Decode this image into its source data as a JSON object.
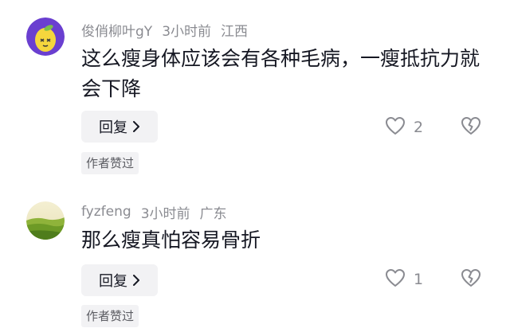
{
  "comments": [
    {
      "username": "俊俏柳叶gY",
      "time": "3小时前",
      "location": "江西",
      "content": "这么瘦身体应该会有各种毛病，一瘦抵抗力就会下降",
      "reply_label": "回复",
      "like_count": "2",
      "author_tag": "作者赞过",
      "avatar_icon": "lemon-avatar-icon"
    },
    {
      "username": "fyzfeng",
      "time": "3小时前",
      "location": "广东",
      "content": "那么瘦真怕容易骨折",
      "reply_label": "回复",
      "like_count": "1",
      "author_tag": "作者赞过",
      "avatar_icon": "landscape-avatar-icon"
    }
  ],
  "colors": {
    "meta_text": "#8a8b91",
    "content_text": "#161823",
    "button_bg": "#f2f2f4",
    "avatar_purple": "#6a3fd0",
    "lemon": "#f5d63d"
  },
  "icons": [
    "chevron-right-icon",
    "heart-outline-icon",
    "broken-heart-icon"
  ]
}
